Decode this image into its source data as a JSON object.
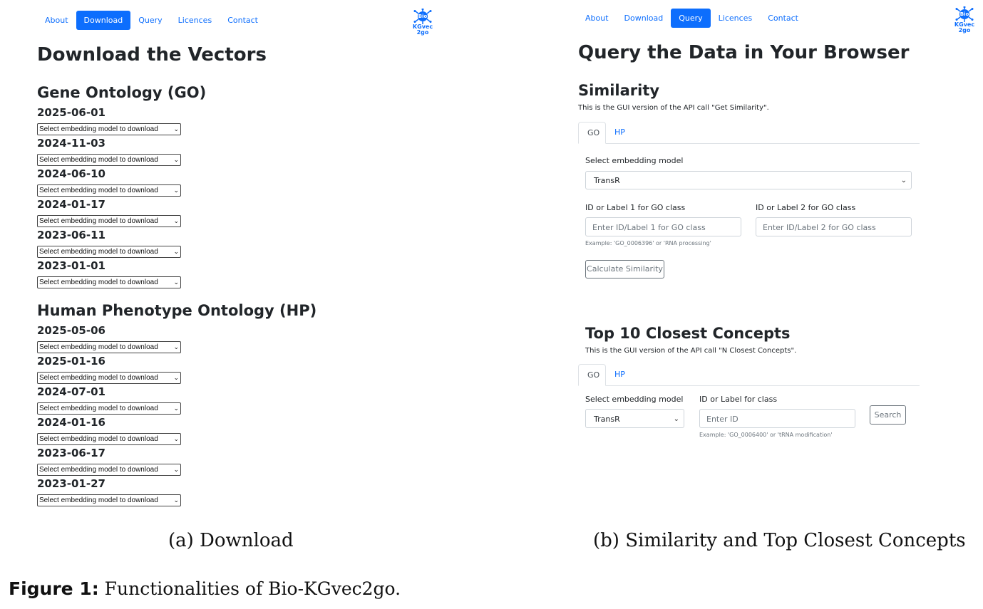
{
  "nav_a": {
    "items": [
      {
        "label": "About",
        "active": false
      },
      {
        "label": "Download",
        "active": true
      },
      {
        "label": "Query",
        "active": false
      },
      {
        "label": "Licences",
        "active": false
      },
      {
        "label": "Contact",
        "active": false
      }
    ]
  },
  "nav_b": {
    "items": [
      {
        "label": "About",
        "active": false
      },
      {
        "label": "Download",
        "active": false
      },
      {
        "label": "Query",
        "active": true
      },
      {
        "label": "Licences",
        "active": false
      },
      {
        "label": "Contact",
        "active": false
      }
    ]
  },
  "logo": {
    "line1": "Bio",
    "line2": "KGvec",
    "line3": "2go",
    "color": "#0d6efd"
  },
  "download": {
    "title": "Download the Vectors",
    "select_placeholder": "Select embedding model to download",
    "go": {
      "heading": "Gene Ontology (GO)",
      "dates": [
        "2025-06-01",
        "2024-11-03",
        "2024-06-10",
        "2024-01-17",
        "2023-06-11",
        "2023-01-01"
      ]
    },
    "hp": {
      "heading": "Human Phenotype Ontology (HP)",
      "dates": [
        "2025-05-06",
        "2025-01-16",
        "2024-07-01",
        "2024-01-16",
        "2023-06-17",
        "2023-01-27"
      ]
    }
  },
  "query": {
    "title": "Query the Data in Your Browser",
    "similarity": {
      "heading": "Similarity",
      "description": "This is the GUI version of the API call \"Get Similarity\".",
      "tabs": [
        "GO",
        "HP"
      ],
      "model_label": "Select embedding model",
      "model_value": "TransR",
      "id1_label": "ID or Label 1 for GO class",
      "id1_placeholder": "Enter ID/Label 1 for GO class",
      "id2_label": "ID or Label 2 for GO class",
      "id2_placeholder": "Enter ID/Label 2 for GO class",
      "example": "Example: 'GO_0006396' or 'RNA processing'",
      "button": "Calculate Similarity"
    },
    "closest": {
      "heading": "Top 10 Closest Concepts",
      "description": "This is the GUI version of the API call \"N Closest Concepts\".",
      "tabs": [
        "GO",
        "HP"
      ],
      "model_label": "Select embedding model",
      "model_value": "TransR",
      "id_label": "ID or Label for class",
      "id_placeholder": "Enter ID",
      "example": "Example: 'GO_0006400' or 'tRNA modification'",
      "button": "Search"
    }
  },
  "captions": {
    "a": "(a) Download",
    "b": "(b) Similarity and Top Closest Concepts",
    "figure_label": "Figure 1:",
    "figure_text": " Functionalities of Bio-KGvec2go."
  },
  "colors": {
    "accent": "#0d6efd"
  }
}
